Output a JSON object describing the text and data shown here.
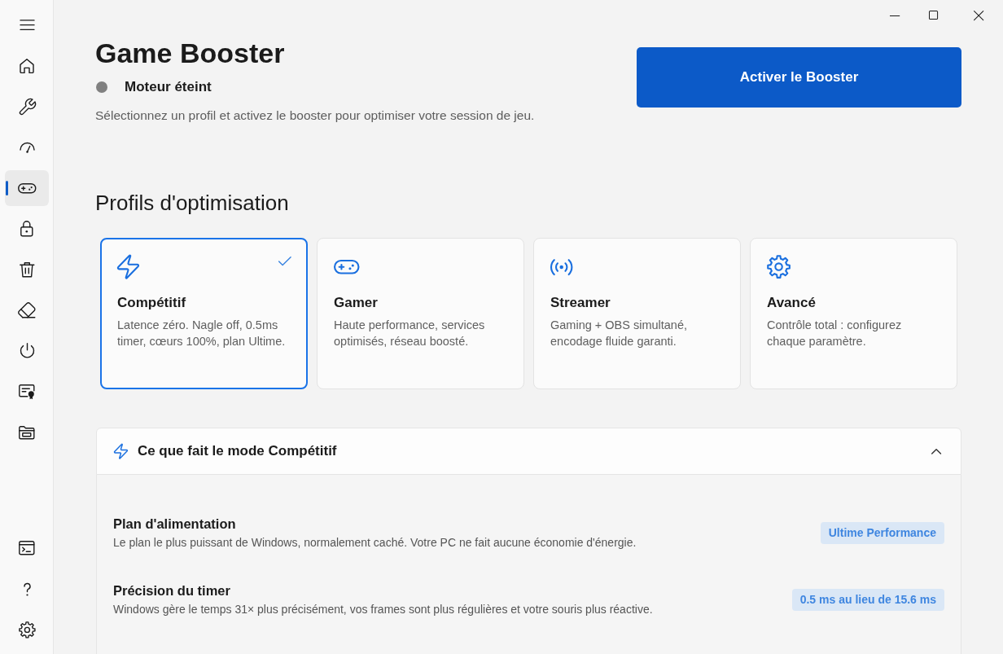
{
  "sidebar": {
    "items": [
      {
        "kind": "home",
        "selected": false
      },
      {
        "kind": "wrench",
        "selected": false
      },
      {
        "kind": "gauge",
        "selected": false
      },
      {
        "kind": "gamepad",
        "selected": true
      },
      {
        "kind": "lock",
        "selected": false
      },
      {
        "kind": "trash",
        "selected": false
      },
      {
        "kind": "eraser",
        "selected": false
      },
      {
        "kind": "power",
        "selected": false
      },
      {
        "kind": "certificate",
        "selected": false
      },
      {
        "kind": "folder",
        "selected": false
      }
    ],
    "footer_items": [
      {
        "kind": "terminal",
        "selected": false
      },
      {
        "kind": "help",
        "selected": false
      },
      {
        "kind": "settings",
        "selected": false
      }
    ]
  },
  "header": {
    "title": "Game Booster",
    "status": {
      "label": "Moteur éteint",
      "on": false
    },
    "description": "Sélectionnez un profil et activez le booster pour optimiser votre session de jeu.",
    "action_button": "Activer le Booster"
  },
  "profiles": {
    "heading": "Profils d'optimisation",
    "items": [
      {
        "kind": "bolt",
        "title": "Compétitif",
        "description": "Latence zéro. Nagle off, 0.5ms timer, cœurs 100%, plan Ultime.",
        "selected": true
      },
      {
        "kind": "gamepad",
        "title": "Gamer",
        "description": "Haute performance, services optimisés, réseau boosté.",
        "selected": false
      },
      {
        "kind": "broadcast",
        "title": "Streamer",
        "description": "Gaming + OBS simultané, encodage fluide garanti.",
        "selected": false
      },
      {
        "kind": "gear",
        "title": "Avancé",
        "description": "Contrôle total : configurez chaque paramètre.",
        "selected": false
      }
    ]
  },
  "details": {
    "title": "Ce que fait le mode Compétitif",
    "expanded": true,
    "rows": [
      {
        "title": "Plan d'alimentation",
        "description": "Le plan le plus puissant de Windows, normalement caché. Votre PC ne fait aucune économie d'énergie.",
        "value": "Ultime Performance"
      },
      {
        "title": "Précision du timer",
        "description": "Windows gère le temps 31× plus précisément, vos frames sont plus régulières et votre souris plus réactive.",
        "value": "0.5 ms au lieu de 15.6 ms"
      }
    ]
  }
}
